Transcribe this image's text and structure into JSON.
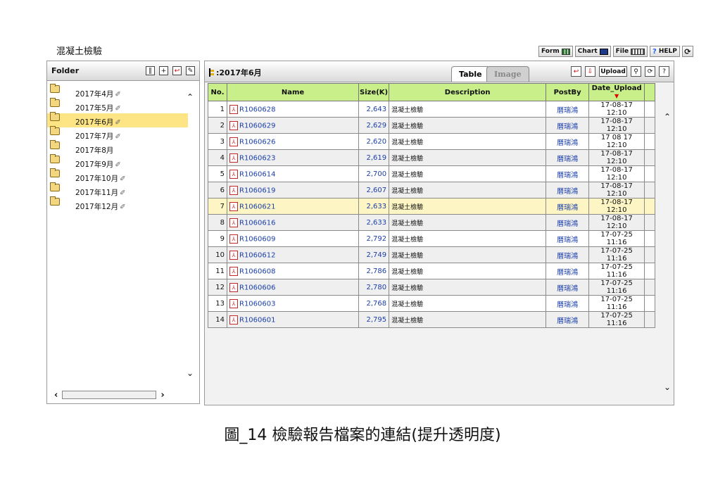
{
  "app": {
    "title": "混凝土檢驗"
  },
  "toolbar": {
    "form_label": "Form",
    "chart_label": "Chart",
    "file_label": "File",
    "help_label": "HELP"
  },
  "folder_panel": {
    "title": "Folder",
    "items": [
      {
        "label": "2017年4月",
        "clip": true
      },
      {
        "label": "2017年5月",
        "clip": true
      },
      {
        "label": "2017年6月",
        "clip": true,
        "selected": true
      },
      {
        "label": "2017年7月",
        "clip": true
      },
      {
        "label": "2017年8月",
        "clip": false
      },
      {
        "label": "2017年9月",
        "clip": true
      },
      {
        "label": "2017年10月",
        "clip": true
      },
      {
        "label": "2017年11月",
        "clip": true
      },
      {
        "label": "2017年12月",
        "clip": true
      }
    ]
  },
  "main_panel": {
    "path": ":2017年6月",
    "tabs": {
      "table": "Table",
      "image": "Image"
    },
    "upload_label": "Upload",
    "columns": [
      "No.",
      "Name",
      "Size(K)",
      "Description",
      "PostBy",
      "Date_Upload"
    ],
    "rows": [
      {
        "no": "1",
        "name": "R1060628",
        "size": "2,643",
        "desc": "混凝土檢驗",
        "postby": "曆瑞鴻",
        "date": "17-08-17 12:10"
      },
      {
        "no": "2",
        "name": "R1060629",
        "size": "2,629",
        "desc": "混凝土檢驗",
        "postby": "曆瑞鴻",
        "date": "17-08-17 12:10"
      },
      {
        "no": "3",
        "name": "R1060626",
        "size": "2,620",
        "desc": "混凝土檢驗",
        "postby": "曆瑞鴻",
        "date": "17 08 17 12:10"
      },
      {
        "no": "4",
        "name": "R1060623",
        "size": "2,619",
        "desc": "混凝土檢驗",
        "postby": "曆瑞鴻",
        "date": "17-08-17 12:10"
      },
      {
        "no": "5",
        "name": "R1060614",
        "size": "2,700",
        "desc": "混凝土檢驗",
        "postby": "曆瑞鴻",
        "date": "17-08-17 12:10"
      },
      {
        "no": "6",
        "name": "R1060619",
        "size": "2,607",
        "desc": "混凝土檢驗",
        "postby": "曆瑞鴻",
        "date": "17-08-17 12:10"
      },
      {
        "no": "7",
        "name": "R1060621",
        "size": "2,633",
        "desc": "混凝土檢驗",
        "postby": "曆瑞鴻",
        "date": "17-08-17 12:10"
      },
      {
        "no": "8",
        "name": "R1060616",
        "size": "2,633",
        "desc": "混凝土檢驗",
        "postby": "曆瑞鴻",
        "date": "17-08-17 12:10"
      },
      {
        "no": "9",
        "name": "R1060609",
        "size": "2,792",
        "desc": "混凝土檢驗",
        "postby": "曆瑞鴻",
        "date": "17-07-25 11:16"
      },
      {
        "no": "10",
        "name": "R1060612",
        "size": "2,749",
        "desc": "混凝土檢驗",
        "postby": "曆瑞鴻",
        "date": "17-07-25 11:16"
      },
      {
        "no": "11",
        "name": "R1060608",
        "size": "2,786",
        "desc": "混凝土檢驗",
        "postby": "曆瑞鴻",
        "date": "17-07-25 11:16"
      },
      {
        "no": "12",
        "name": "R1060606",
        "size": "2,780",
        "desc": "混凝土檢驗",
        "postby": "曆瑞鴻",
        "date": "17-07-25 11:16"
      },
      {
        "no": "13",
        "name": "R1060603",
        "size": "2,768",
        "desc": "混凝土檢驗",
        "postby": "曆瑞鴻",
        "date": "17-07-25 11:16"
      },
      {
        "no": "14",
        "name": "R1060601",
        "size": "2,795",
        "desc": "混凝土檢驗",
        "postby": "曆瑞鴻",
        "date": "17-07-25 11:16"
      }
    ]
  },
  "caption": "圖_14 檢驗報告檔案的連結(提升透明度)"
}
